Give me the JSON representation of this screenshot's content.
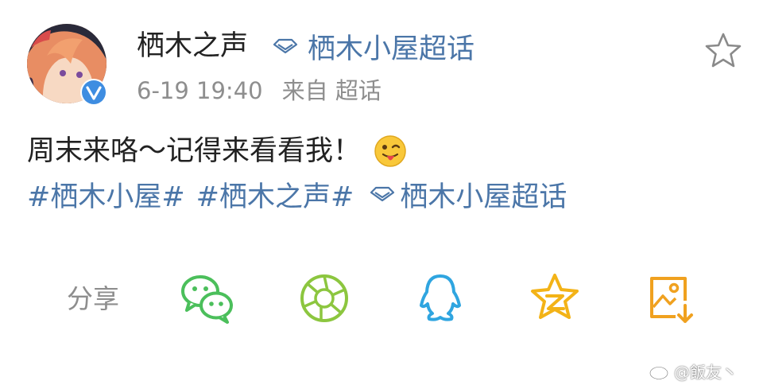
{
  "post": {
    "author": "栖木之声",
    "topic_link": "栖木小屋超话",
    "time": "6-19 19:40",
    "source": "来自 超话",
    "text": "周末来咯～记得来看看我！",
    "tags": [
      "#栖木小屋#",
      "#栖木之声#"
    ],
    "super_topic": "栖木小屋超话"
  },
  "share": {
    "label": "分享",
    "targets": [
      {
        "icon": "wechat-icon",
        "color": "#4bbf5b"
      },
      {
        "icon": "moments-icon",
        "color": "#8cc63f"
      },
      {
        "icon": "qq-icon",
        "color": "#2fa5e0"
      },
      {
        "icon": "qzone-icon",
        "color": "#f3b317"
      },
      {
        "icon": "save-image-icon",
        "color": "#f0a11f"
      }
    ]
  },
  "watermark": "@飯友丶",
  "colors": {
    "link": "#4b76a8",
    "text": "#222222",
    "meta": "#8e8e8e",
    "verified": "#3e8de1"
  }
}
